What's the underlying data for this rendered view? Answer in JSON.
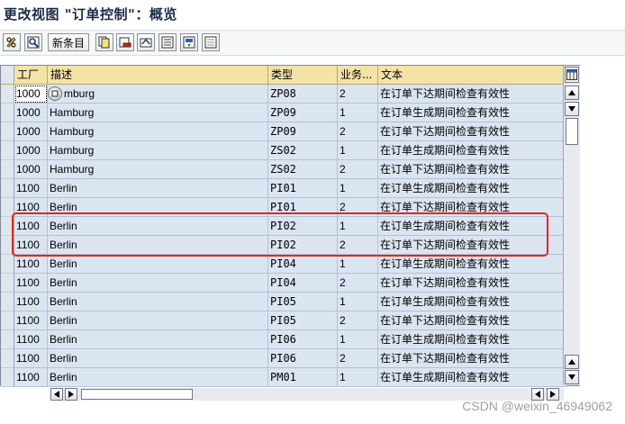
{
  "window": {
    "title": "更改视图 \"订单控制\"：概览"
  },
  "toolbar": {
    "new_entries_label": "新条目"
  },
  "table": {
    "columns": [
      "工厂",
      "描述",
      "类型",
      "业务...",
      "文本"
    ],
    "rows": [
      {
        "plant": "1000",
        "description": "mburg",
        "type": "ZP08",
        "biz": "2",
        "text": "在订单下达期间检查有效性"
      },
      {
        "plant": "1000",
        "description": "Hamburg",
        "type": "ZP09",
        "biz": "1",
        "text": "在订单生成期间检查有效性"
      },
      {
        "plant": "1000",
        "description": "Hamburg",
        "type": "ZP09",
        "biz": "2",
        "text": "在订单下达期间检查有效性"
      },
      {
        "plant": "1000",
        "description": "Hamburg",
        "type": "ZS02",
        "biz": "1",
        "text": "在订单生成期间检查有效性"
      },
      {
        "plant": "1000",
        "description": "Hamburg",
        "type": "ZS02",
        "biz": "2",
        "text": "在订单下达期间检查有效性"
      },
      {
        "plant": "1100",
        "description": "Berlin",
        "type": "PI01",
        "biz": "1",
        "text": "在订单生成期间检查有效性"
      },
      {
        "plant": "1100",
        "description": "Berlin",
        "type": "PI01",
        "biz": "2",
        "text": "在订单下达期间检查有效性"
      },
      {
        "plant": "1100",
        "description": "Berlin",
        "type": "PI02",
        "biz": "1",
        "text": "在订单生成期间检查有效性"
      },
      {
        "plant": "1100",
        "description": "Berlin",
        "type": "PI02",
        "biz": "2",
        "text": "在订单下达期间检查有效性"
      },
      {
        "plant": "1100",
        "description": "Berlin",
        "type": "PI04",
        "biz": "1",
        "text": "在订单生成期间检查有效性"
      },
      {
        "plant": "1100",
        "description": "Berlin",
        "type": "PI04",
        "biz": "2",
        "text": "在订单下达期间检查有效性"
      },
      {
        "plant": "1100",
        "description": "Berlin",
        "type": "PI05",
        "biz": "1",
        "text": "在订单生成期间检查有效性"
      },
      {
        "plant": "1100",
        "description": "Berlin",
        "type": "PI05",
        "biz": "2",
        "text": "在订单下达期间检查有效性"
      },
      {
        "plant": "1100",
        "description": "Berlin",
        "type": "PI06",
        "biz": "1",
        "text": "在订单生成期间检查有效性"
      },
      {
        "plant": "1100",
        "description": "Berlin",
        "type": "PI06",
        "biz": "2",
        "text": "在订单下达期间检查有效性"
      },
      {
        "plant": "1100",
        "description": "Berlin",
        "type": "PM01",
        "biz": "1",
        "text": "在订单生成期间检查有效性"
      }
    ]
  },
  "watermark": "CSDN @weixin_46949062",
  "colors": {
    "highlight": "#e3261f",
    "cell": "#dbe5f1",
    "header": "#f3e3a8"
  }
}
